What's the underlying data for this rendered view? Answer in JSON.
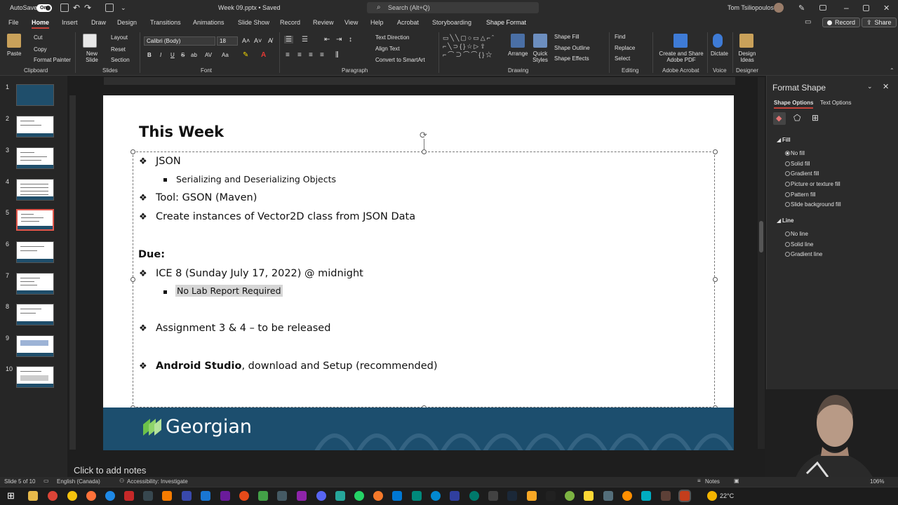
{
  "titlebar": {
    "autosave_label": "AutoSave",
    "autosave_state": "On",
    "doc_title": "Week 09.pptx • Saved",
    "search_placeholder": "Search (Alt+Q)",
    "user_name": "Tom Tsiliopoulos"
  },
  "tabs": [
    "File",
    "Home",
    "Insert",
    "Draw",
    "Design",
    "Transitions",
    "Animations",
    "Slide Show",
    "Record",
    "Review",
    "View",
    "Help",
    "Acrobat",
    "Storyboarding",
    "Shape Format"
  ],
  "active_tab": "Home",
  "top_right": {
    "record_label": "Record",
    "share_label": "Share"
  },
  "ribbon": {
    "clipboard": {
      "paste": "Paste",
      "cut": "Cut",
      "copy": "Copy",
      "format_painter": "Format Painter",
      "group": "Clipboard"
    },
    "slides": {
      "new_slide": "New Slide",
      "layout": "Layout",
      "reset": "Reset",
      "section": "Section",
      "group": "Slides"
    },
    "font": {
      "font_name": "Calibri (Body)",
      "font_size": "18",
      "group": "Font",
      "buttons": [
        "B",
        "I",
        "U",
        "S",
        "ab",
        "AV",
        "Aa"
      ]
    },
    "paragraph": {
      "text_direction": "Text Direction",
      "align_text": "Align Text",
      "convert_smartart": "Convert to SmartArt",
      "group": "Paragraph"
    },
    "drawing": {
      "arrange": "Arrange",
      "quick_styles": "Quick Styles",
      "shape_fill": "Shape Fill",
      "shape_outline": "Shape Outline",
      "shape_effects": "Shape Effects",
      "group": "Drawing"
    },
    "editing": {
      "find": "Find",
      "replace": "Replace",
      "select": "Select",
      "group": "Editing"
    },
    "acrobat": {
      "create_share": "Create and Share Adobe PDF",
      "group": "Adobe Acrobat"
    },
    "voice": {
      "dictate": "Dictate",
      "group": "Voice"
    },
    "designer": {
      "design_ideas": "Design Ideas",
      "group": "Designer"
    }
  },
  "thumbnails": [
    "1",
    "2",
    "3",
    "4",
    "5",
    "6",
    "7",
    "8",
    "9",
    "10"
  ],
  "selected_slide": 5,
  "slide": {
    "title": "This Week",
    "items": [
      {
        "text": "JSON",
        "level": 1
      },
      {
        "text": "Serializing and Deserializing Objects",
        "level": 2
      },
      {
        "text": "Tool: GSON (Maven)",
        "level": 1
      },
      {
        "text": "Create instances of Vector2D class from JSON Data",
        "level": 1
      }
    ],
    "due_label": "Due:",
    "due_items": [
      {
        "text": "ICE 8 (Sunday July 17, 2022) @ midnight",
        "level": 1
      },
      {
        "text": "No Lab Report Required",
        "level": 2,
        "highlighted": true
      },
      {
        "text": "Assignment 3 & 4 – to be released",
        "level": 1
      },
      {
        "bold_text": "Android Studio",
        "text": ", download and Setup (recommended)",
        "level": 1
      }
    ],
    "footer_brand": "Georgian",
    "footer_color": "#1c4e6e"
  },
  "notes_placeholder": "Click to add notes",
  "format_pane": {
    "title": "Format Shape",
    "tab_shape": "Shape Options",
    "tab_text": "Text Options",
    "fill_header": "Fill",
    "fill_options": [
      "No fill",
      "Solid fill",
      "Gradient fill",
      "Picture or texture fill",
      "Pattern fill",
      "Slide background fill"
    ],
    "fill_selected": "No fill",
    "line_header": "Line",
    "line_options": [
      "No line",
      "Solid line",
      "Gradient line"
    ]
  },
  "status": {
    "slide_pos": "Slide 5 of 10",
    "language": "English (Canada)",
    "accessibility": "Accessibility: Investigate",
    "notes": "Notes",
    "zoom": "106%"
  },
  "taskbar": {
    "temperature": "22°C"
  },
  "colors": {
    "accent": "#c4433a",
    "selected_thumb": "#e2574c",
    "brand_green": "#6cc24a"
  }
}
